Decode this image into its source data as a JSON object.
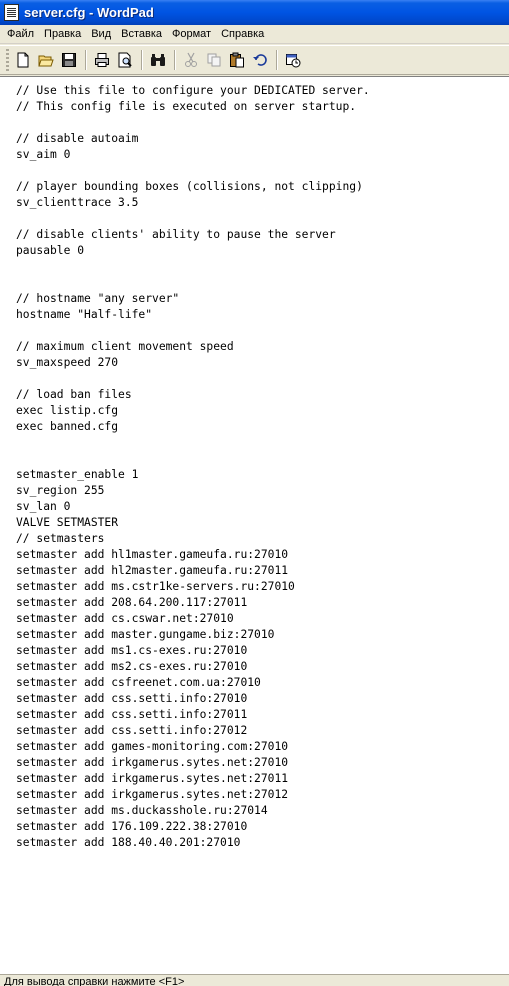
{
  "window": {
    "title": "server.cfg - WordPad"
  },
  "menu": [
    {
      "label": "Файл"
    },
    {
      "label": "Правка"
    },
    {
      "label": "Вид"
    },
    {
      "label": "Вставка"
    },
    {
      "label": "Формат"
    },
    {
      "label": "Справка"
    }
  ],
  "toolbar": {
    "buttons": [
      "new-document",
      "open",
      "save",
      "print",
      "print-preview",
      "find",
      "cut",
      "copy",
      "paste",
      "undo",
      "insert-date-time"
    ]
  },
  "document": {
    "lines": [
      "// Use this file to configure your DEDICATED server.",
      "// This config file is executed on server startup.",
      "",
      "// disable autoaim",
      "sv_aim 0",
      "",
      "// player bounding boxes (collisions, not clipping)",
      "sv_clienttrace 3.5",
      "",
      "// disable clients' ability to pause the server",
      "pausable 0",
      "",
      "",
      "// hostname \"any server\"",
      "hostname \"Half-life\"",
      "",
      "// maximum client movement speed",
      "sv_maxspeed 270",
      "",
      "// load ban files",
      "exec listip.cfg",
      "exec banned.cfg",
      "",
      "",
      "setmaster_enable 1",
      "sv_region 255",
      "sv_lan 0",
      "VALVE SETMASTER",
      "// setmasters",
      "setmaster add hl1master.gameufa.ru:27010",
      "setmaster add hl2master.gameufa.ru:27011",
      "setmaster add ms.cstr1ke-servers.ru:27010",
      "setmaster add 208.64.200.117:27011",
      "setmaster add cs.cswar.net:27010",
      "setmaster add master.gungame.biz:27010",
      "setmaster add ms1.cs-exes.ru:27010",
      "setmaster add ms2.cs-exes.ru:27010",
      "setmaster add csfreenet.com.ua:27010",
      "setmaster add css.setti.info:27010",
      "setmaster add css.setti.info:27011",
      "setmaster add css.setti.info:27012",
      "setmaster add games-monitoring.com:27010",
      "setmaster add irkgamerus.sytes.net:27010",
      "setmaster add irkgamerus.sytes.net:27011",
      "setmaster add irkgamerus.sytes.net:27012",
      "setmaster add ms.duckasshole.ru:27014",
      "setmaster add 176.109.222.38:27010",
      "setmaster add 188.40.40.201:27010"
    ]
  },
  "status": {
    "text": "Для вывода справки нажмите <F1>"
  }
}
